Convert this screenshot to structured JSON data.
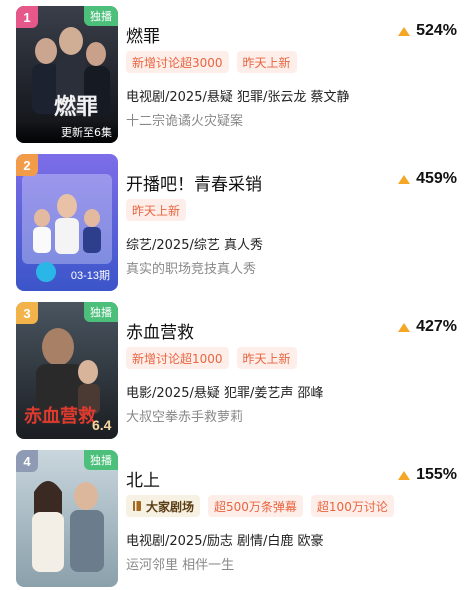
{
  "colors": {
    "rank_1": "#e6588a",
    "rank_2": "#f29c4a",
    "rank_3": "#f2b44a",
    "rank_4": "#8f9bb5",
    "growth_arrow": "#f5a623",
    "tag_text": "#e8653f",
    "tag_bg": "#fdeeea",
    "exclusive": "#4cbf7a"
  },
  "items": [
    {
      "rank": "1",
      "exclusive": "独播",
      "poster_caption": "燃罪",
      "poster_update": "更新至6集",
      "title": "燃罪",
      "growth": "524%",
      "tags": [
        "新增讨论超3000",
        "昨天上新"
      ],
      "meta": "电视剧/2025/悬疑 犯罪/张云龙 蔡文静",
      "desc": "十二宗诡谲火灾疑案"
    },
    {
      "rank": "2",
      "poster_episode": "03-13期",
      "title": "开播吧！青春采销",
      "growth": "459%",
      "tags": [
        "昨天上新"
      ],
      "meta": "综艺/2025/综艺 真人秀",
      "desc": "真实的职场竞技真人秀"
    },
    {
      "rank": "3",
      "exclusive": "独播",
      "poster_caption": "赤血营救",
      "poster_date": "6.4",
      "title": "赤血营救",
      "growth": "427%",
      "tags": [
        "新增讨论超1000",
        "昨天上新"
      ],
      "meta": "电影/2025/悬疑 犯罪/姜艺声 邵峰",
      "desc": "大叔空拳赤手救萝莉"
    },
    {
      "rank": "4",
      "exclusive": "独播",
      "title": "北上",
      "growth": "155%",
      "brand_tag": "大家剧场",
      "brand_icon": "book-icon",
      "tags": [
        "超500万条弹幕",
        "超100万讨论"
      ],
      "meta": "电视剧/2025/励志 剧情/白鹿 欧豪",
      "desc": "运河邻里 相伴一生"
    }
  ]
}
